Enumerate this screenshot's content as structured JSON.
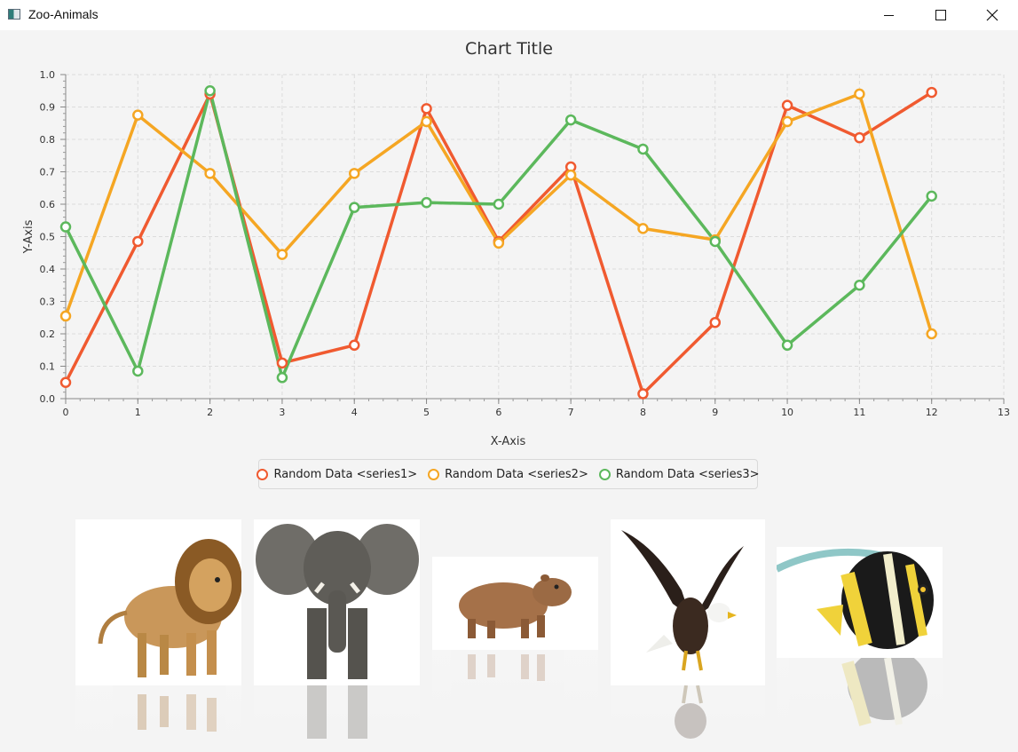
{
  "window": {
    "title": "Zoo-Animals",
    "minimize_icon": "minimize-icon",
    "maximize_icon": "maximize-icon",
    "close_icon": "close-icon"
  },
  "chart_data": {
    "type": "line",
    "title": "Chart Title",
    "xlabel": "X-Axis",
    "ylabel": "Y-Axis",
    "xlim": [
      0,
      13
    ],
    "ylim": [
      0,
      1.0
    ],
    "x_ticks": [
      "0",
      "1",
      "2",
      "3",
      "4",
      "5",
      "6",
      "7",
      "8",
      "9",
      "10",
      "11",
      "12",
      "13"
    ],
    "y_ticks": [
      "0.0",
      "0.1",
      "0.2",
      "0.3",
      "0.4",
      "0.5",
      "0.6",
      "0.7",
      "0.8",
      "0.9",
      "1.0"
    ],
    "grid": true,
    "legend_position": "bottom",
    "x": [
      0,
      1,
      2,
      3,
      4,
      5,
      6,
      7,
      8,
      9,
      10,
      11,
      12
    ],
    "series": [
      {
        "name": "Random Data <series1>",
        "color": "#f05a30",
        "values": [
          0.05,
          0.485,
          0.94,
          0.11,
          0.165,
          0.895,
          0.485,
          0.715,
          0.015,
          0.235,
          0.905,
          0.805,
          0.945
        ]
      },
      {
        "name": "Random Data <series2>",
        "color": "#f5a623",
        "values": [
          0.255,
          0.875,
          0.695,
          0.445,
          0.695,
          0.855,
          0.48,
          0.69,
          0.525,
          0.49,
          0.855,
          0.94,
          0.2
        ]
      },
      {
        "name": "Random Data <series3>",
        "color": "#5cb85c",
        "values": [
          0.53,
          0.085,
          0.95,
          0.065,
          0.59,
          0.605,
          0.6,
          0.86,
          0.77,
          0.485,
          0.165,
          0.35,
          0.625
        ]
      }
    ]
  },
  "animals": [
    {
      "name": "lion",
      "icon": "lion-image"
    },
    {
      "name": "elephant",
      "icon": "elephant-image"
    },
    {
      "name": "capybara",
      "icon": "capybara-image"
    },
    {
      "name": "eagle",
      "icon": "eagle-image"
    },
    {
      "name": "fish",
      "icon": "fish-image"
    }
  ]
}
